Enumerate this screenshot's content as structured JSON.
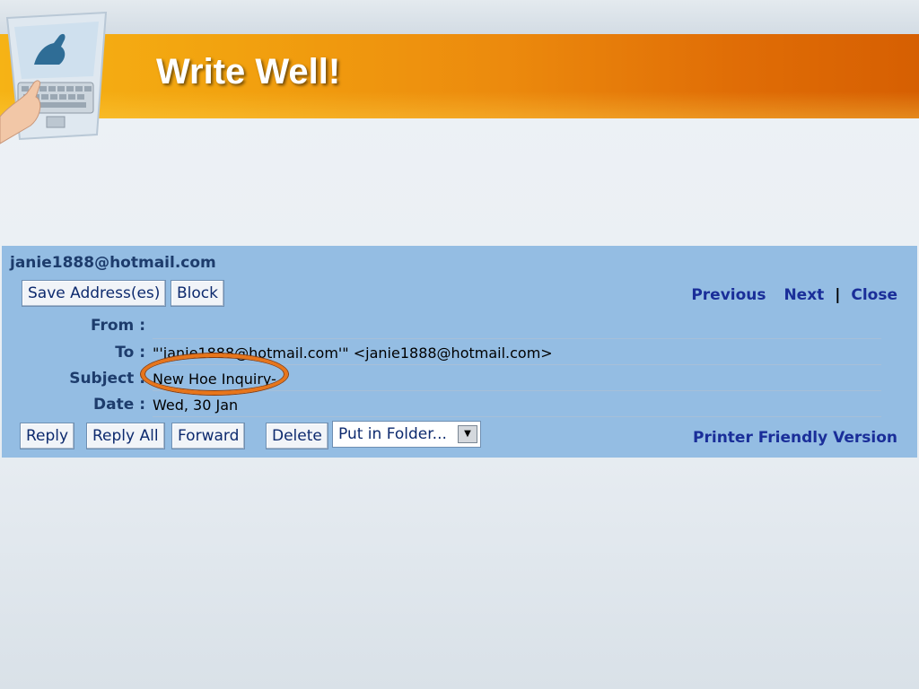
{
  "slide": {
    "title": "Write Well!"
  },
  "email": {
    "sender": "janie1888@hotmail.com",
    "buttons_top": {
      "save_address": "Save Address(es)",
      "block": "Block"
    },
    "nav": {
      "previous": "Previous",
      "next": "Next",
      "separator": "|",
      "close": "Close"
    },
    "fields": {
      "from_label": "From :",
      "from_value": "",
      "to_label": "To :",
      "to_value": "\"'janie1888@hotmail.com'\" <janie1888@hotmail.com>",
      "subject_label": "Subject :",
      "subject_value": "New Hoe Inquiry-",
      "date_label": "Date :",
      "date_value": "Wed, 30 Jan"
    },
    "buttons_bottom": {
      "reply": "Reply",
      "reply_all": "Reply All",
      "forward": "Forward",
      "delete": "Delete"
    },
    "folder_select": {
      "selected": "Put in Folder..."
    },
    "printer_friendly": "Printer Friendly Version"
  },
  "colors": {
    "banner_start": "#f6b315",
    "banner_end": "#d65f02",
    "mail_panel": "#94bde3",
    "link_blue": "#1a2e99",
    "highlight": "#e8751a"
  }
}
